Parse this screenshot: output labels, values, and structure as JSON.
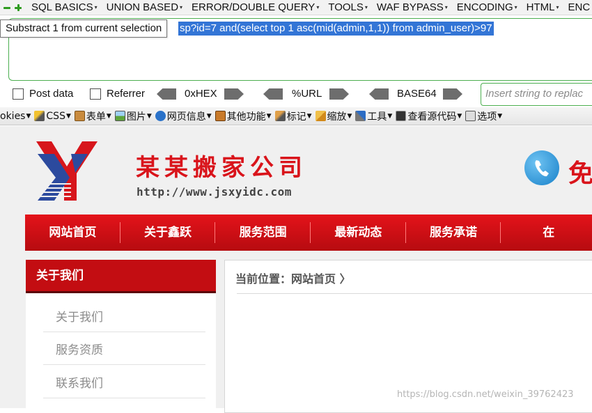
{
  "hackbar": {
    "menu": [
      "SQL BASICS",
      "UNION BASED",
      "ERROR/DOUBLE QUERY",
      "TOOLS",
      "WAF BYPASS",
      "ENCODING",
      "HTML",
      "ENC"
    ],
    "url_visible": "sp?id=7 and(select top 1 asc(mid(admin,1,1)) from admin_user)>97",
    "tooltip": "Substract 1 from current selection",
    "post_data_label": "Post data",
    "referrer_label": "Referrer",
    "hex_label": "0xHEX",
    "url_label": "%URL",
    "base64_label": "BASE64",
    "replace_placeholder": "Insert string to replac"
  },
  "webdev": {
    "items": [
      "okies",
      "CSS",
      "表单",
      "图片",
      "网页信息",
      "其他功能",
      "标记",
      "缩放",
      "工具",
      "查看源代码",
      "选项"
    ]
  },
  "site": {
    "company_name": "某某搬家公司",
    "company_url": "http://www.jsxyidc.com",
    "free_text": "免",
    "nav": [
      "网站首页",
      "关于鑫跃",
      "服务范围",
      "最新动态",
      "服务承诺",
      "在"
    ],
    "side_title": "关于我们",
    "side_items": [
      "关于我们",
      "服务资质",
      "联系我们"
    ],
    "breadcrumb": "当前位置：网站首页 〉",
    "watermark": "https://blog.csdn.net/weixin_39762423"
  },
  "colors": {
    "accent_red": "#d9141b",
    "hackbar_green": "#4caf50",
    "selection_blue": "#3375d6"
  }
}
